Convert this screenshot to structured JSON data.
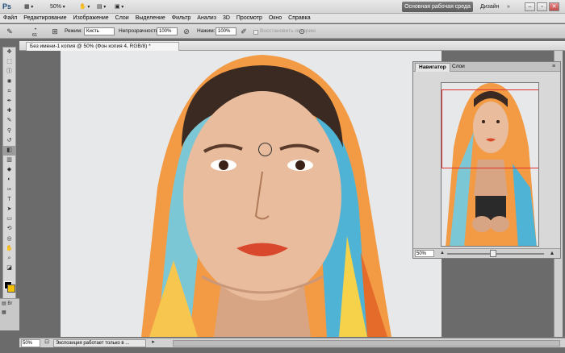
{
  "app": {
    "logo": "Ps",
    "zoom": "50%",
    "workspace_active": "Основная рабочая среда",
    "workspace_other": "Дизайн",
    "workspace_more": "»"
  },
  "window_controls": {
    "minimize": "–",
    "restore": "▫",
    "close": "✕"
  },
  "menu": [
    "Файл",
    "Редактирование",
    "Изображение",
    "Слои",
    "Выделение",
    "Фильтр",
    "Анализ",
    "3D",
    "Просмотр",
    "Окно",
    "Справка"
  ],
  "options": {
    "brush_size": "61",
    "mode_label": "Режим:",
    "mode_value": "Кисть",
    "opacity_label": "Непрозрачность:",
    "opacity_value": "100%",
    "pressure_label": "Нажим:",
    "pressure_value": "100%",
    "history_label": "Восстановить историю"
  },
  "document": {
    "tab_title": "Без имени-1 копия @ 50% (Фон копия 4, RGB/8) *",
    "zoom": "50%",
    "status_message": "Экспозиция работает только в ..."
  },
  "navigator": {
    "tab_active": "Навигатор",
    "tab_other": "Слои",
    "zoom": "50%"
  },
  "colors": {
    "foreground": "#000000",
    "background": "#f5c000",
    "accent": "#e03030"
  }
}
